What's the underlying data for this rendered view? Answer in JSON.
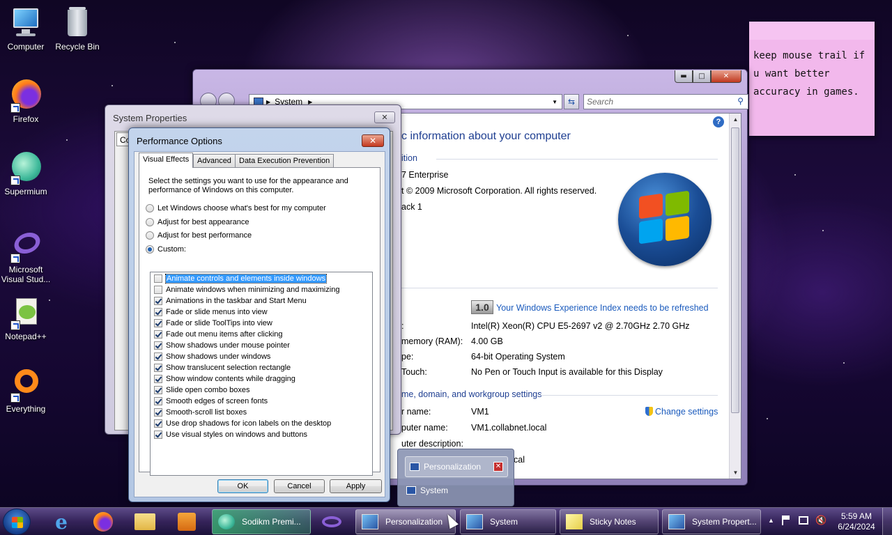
{
  "desktop": {
    "icons": [
      {
        "label": "Computer",
        "icon": "computer-icon"
      },
      {
        "label": "Recycle Bin",
        "icon": "recycle-bin-icon"
      },
      {
        "label": "Firefox",
        "icon": "firefox-icon"
      },
      {
        "label": "Supermium",
        "icon": "supermium-icon"
      },
      {
        "label": "Microsoft Visual Stud...",
        "icon": "visual-studio-icon"
      },
      {
        "label": "Notepad++",
        "icon": "notepadpp-icon"
      },
      {
        "label": "Everything",
        "icon": "everything-icon"
      }
    ]
  },
  "sticky_note": {
    "text": "keep mouse trail if u want better accuracy in games."
  },
  "system_window": {
    "breadcrumb": "System",
    "search_placeholder": "Search",
    "heading": "c information about your computer",
    "edition_section": "ition",
    "edition": "7 Enterprise",
    "copyright": "t © 2009 Microsoft Corporation.  All rights reserved.",
    "service_pack": "ack 1",
    "wei_score": "1.0",
    "wei_link": "Your Windows Experience Index needs to be refreshed",
    "processor_label": ":",
    "processor": "Intel(R) Xeon(R) CPU E5-2697 v2 @ 2.70GHz   2.70 GHz",
    "memory_label": "memory (RAM):",
    "memory": "4.00 GB",
    "systype_label": "pe:",
    "systype": "64-bit Operating System",
    "touch_label": "Touch:",
    "touch": "No Pen or Touch Input is available for this Display",
    "workgroup_section": "me, domain, and workgroup settings",
    "change_settings": "Change settings",
    "computer_name_label": "r name:",
    "computer_name": "VM1",
    "full_name_label": "puter name:",
    "full_name": "VM1.collabnet.local",
    "description_label": "uter description:",
    "domain_partial": "cal"
  },
  "system_properties": {
    "title": "System Properties",
    "tab_stub": "Co"
  },
  "performance_options": {
    "title": "Performance Options",
    "tabs": [
      "Visual Effects",
      "Advanced",
      "Data Execution Prevention"
    ],
    "description": "Select the settings you want to use for the appearance and performance of Windows on this computer.",
    "radios": [
      {
        "label": "Let Windows choose what's best for my computer",
        "selected": false
      },
      {
        "label": "Adjust for best appearance",
        "selected": false
      },
      {
        "label": "Adjust for best performance",
        "selected": false
      },
      {
        "label": "Custom:",
        "selected": true
      }
    ],
    "effects": [
      {
        "label": "Animate controls and elements inside windows",
        "checked": false
      },
      {
        "label": "Animate windows when minimizing and maximizing",
        "checked": false
      },
      {
        "label": "Animations in the taskbar and Start Menu",
        "checked": true
      },
      {
        "label": "Fade or slide menus into view",
        "checked": true
      },
      {
        "label": "Fade or slide ToolTips into view",
        "checked": true
      },
      {
        "label": "Fade out menu items after clicking",
        "checked": true
      },
      {
        "label": "Show shadows under mouse pointer",
        "checked": true
      },
      {
        "label": "Show shadows under windows",
        "checked": true
      },
      {
        "label": "Show translucent selection rectangle",
        "checked": true
      },
      {
        "label": "Show window contents while dragging",
        "checked": true
      },
      {
        "label": "Slide open combo boxes",
        "checked": true
      },
      {
        "label": "Smooth edges of screen fonts",
        "checked": true
      },
      {
        "label": "Smooth-scroll list boxes",
        "checked": true
      },
      {
        "label": "Use drop shadows for icon labels on the desktop",
        "checked": true
      },
      {
        "label": "Use visual styles on windows and buttons",
        "checked": true
      }
    ],
    "ok": "OK",
    "cancel": "Cancel",
    "apply": "Apply"
  },
  "thumbnail_popup": {
    "items": [
      "Personalization",
      "System"
    ]
  },
  "taskbar": {
    "buttons": [
      "Sodikm Premi...",
      "Personalization",
      "System",
      "Sticky Notes",
      "System Propert..."
    ],
    "time": "5:59 AM",
    "date": "6/24/2024"
  }
}
